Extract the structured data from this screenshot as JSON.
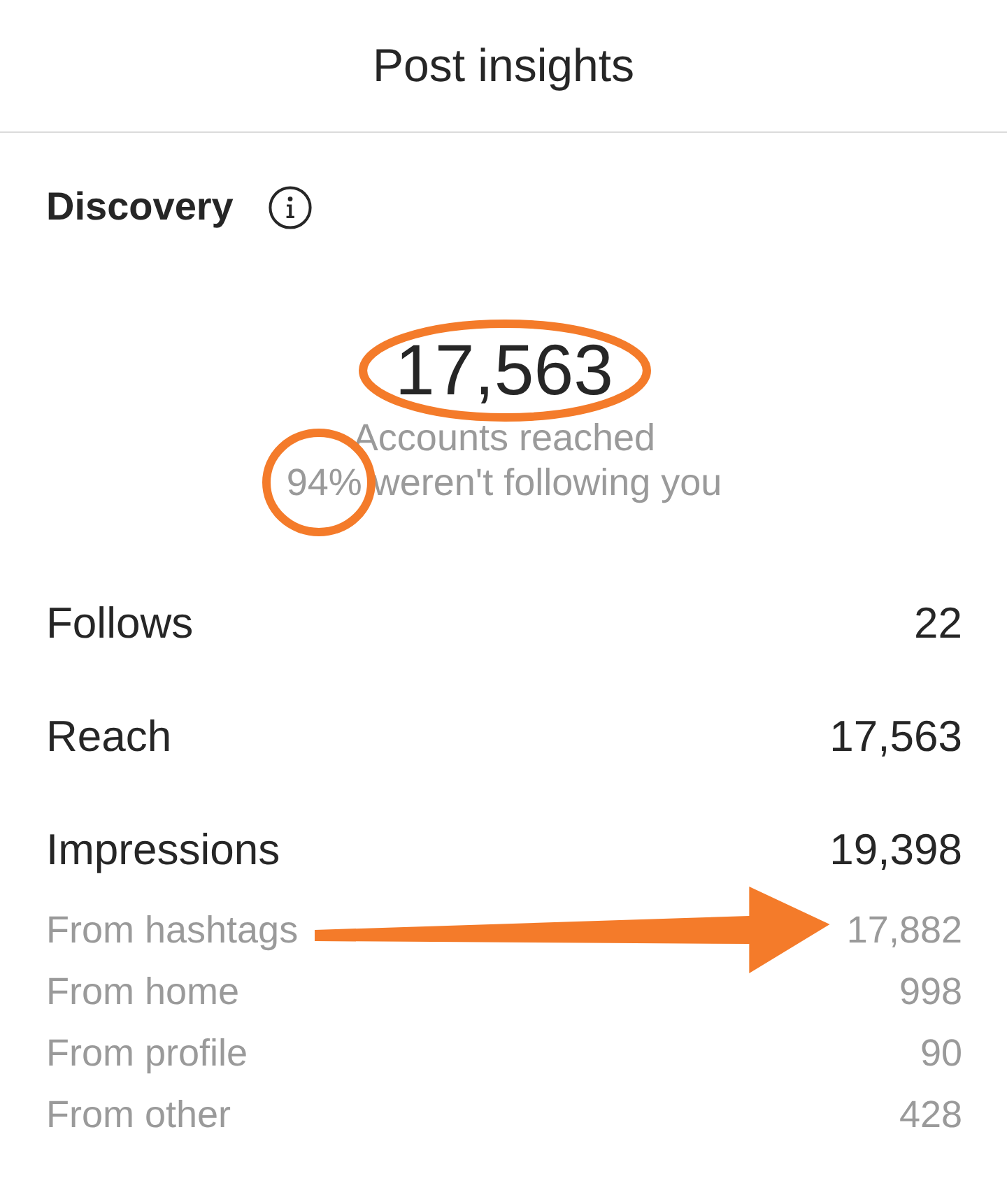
{
  "header": {
    "title": "Post insights"
  },
  "discovery": {
    "title": "Discovery",
    "accounts_reached": {
      "count": "17,563",
      "label": "Accounts reached",
      "circled": true
    },
    "non_followers": {
      "percent": "94%",
      "label": "weren't following you",
      "circled": true
    }
  },
  "metrics": [
    {
      "label": "Follows",
      "value": "22"
    },
    {
      "label": "Reach",
      "value": "17,563"
    },
    {
      "label": "Impressions",
      "value": "19,398",
      "children": [
        {
          "label": "From hashtags",
          "value": "17,882",
          "arrow": true
        },
        {
          "label": "From home",
          "value": "998",
          "arrow": false
        },
        {
          "label": "From profile",
          "value": "90",
          "arrow": false
        },
        {
          "label": "From other",
          "value": "428",
          "arrow": false
        }
      ]
    }
  ]
}
